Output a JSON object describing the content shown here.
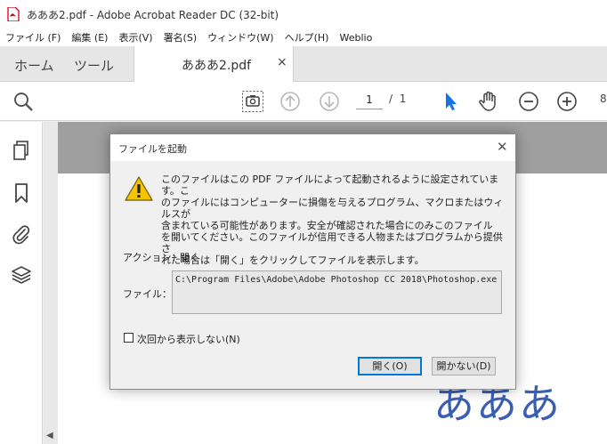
{
  "window": {
    "title": "あああ2.pdf - Adobe Acrobat Reader DC (32-bit)"
  },
  "menu": [
    "ファイル (F)",
    "編集 (E)",
    "表示(V)",
    "署名(S)",
    "ウィンドウ(W)",
    "ヘルプ(H)",
    "Weblio"
  ],
  "tabs": {
    "home": "ホーム",
    "tools": "ツール",
    "document": "あああ2.pdf",
    "close": "×"
  },
  "toolbar": {
    "page_current": "1",
    "page_separator": "/",
    "page_total": "1",
    "zoom_partial": "8"
  },
  "icons": [
    "search-icon",
    "screenshot-icon",
    "page-up-icon",
    "page-down-icon",
    "select-cursor-icon",
    "hand-tool-icon",
    "zoom-out-icon",
    "zoom-in-icon",
    "pages-icon",
    "bookmark-icon",
    "attachment-icon",
    "layers-icon",
    "warning-icon"
  ],
  "page_content": {
    "text": "あああ"
  },
  "dialog": {
    "title": "ファイルを起動",
    "close": "✕",
    "message_lines": [
      "このファイルはこの PDF ファイルによって起動されるように設定されています。こ",
      "のファイルにはコンピューターに損傷を与えるプログラム、マクロまたはウィルスが",
      "含まれている可能性があります。安全が確認された場合にのみこのファイル",
      "を開いてください。このファイルが信用できる人物またはプログラムから提供さ",
      "れた場合は「開く」をクリックしてファイルを表示します。"
    ],
    "action_label": "アクション：",
    "action_value": "開く",
    "file_label": "ファイル：",
    "file_path": "C:\\Program Files\\Adobe\\Adobe Photoshop CC 2018\\Photoshop.exe",
    "checkbox_label": "次回から表示しない(N)",
    "checkbox_checked": false,
    "open_button": "開く(O)",
    "noopen_button": "開かない(D)"
  },
  "colors": {
    "accent": "#0078d7",
    "select_tool": "#1473e6",
    "warning": "#f5c400",
    "pdf_red": "#d0021b",
    "page_text": "#3a5fb0"
  }
}
